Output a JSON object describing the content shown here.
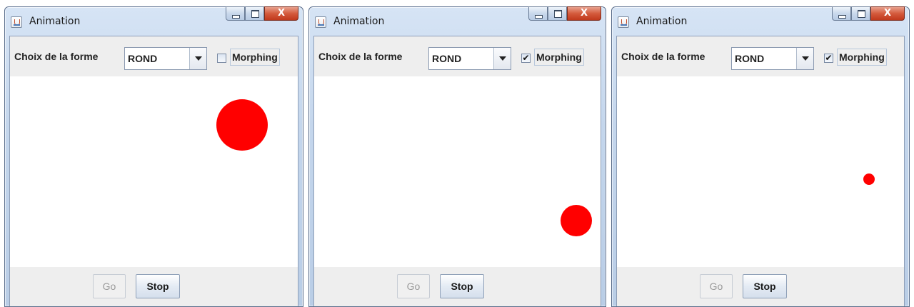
{
  "windows": [
    {
      "title": "Animation",
      "close_label": "X",
      "form_label": "Choix de la forme",
      "form_value": "ROND",
      "morphing_label": "Morphing",
      "morphing_checked": false,
      "check_glyph": "",
      "go_label": "Go",
      "go_enabled": false,
      "stop_label": "Stop",
      "shape": {
        "type": "circle",
        "color": "#ff0000"
      }
    },
    {
      "title": "Animation",
      "close_label": "X",
      "form_label": "Choix de la forme",
      "form_value": "ROND",
      "morphing_label": "Morphing",
      "morphing_checked": true,
      "check_glyph": "✔",
      "go_label": "Go",
      "go_enabled": false,
      "stop_label": "Stop",
      "shape": {
        "type": "circle",
        "color": "#ff0000"
      }
    },
    {
      "title": "Animation",
      "close_label": "X",
      "form_label": "Choix de la forme",
      "form_value": "ROND",
      "morphing_label": "Morphing",
      "morphing_checked": true,
      "check_glyph": "✔",
      "go_label": "Go",
      "go_enabled": false,
      "stop_label": "Stop",
      "shape": {
        "type": "circle",
        "color": "#ff0000"
      }
    }
  ],
  "icons": {
    "app": "java-cup-icon",
    "minimize": "minimize-icon",
    "maximize": "maximize-icon",
    "close": "close-icon",
    "dropdown": "chevron-down-icon"
  }
}
